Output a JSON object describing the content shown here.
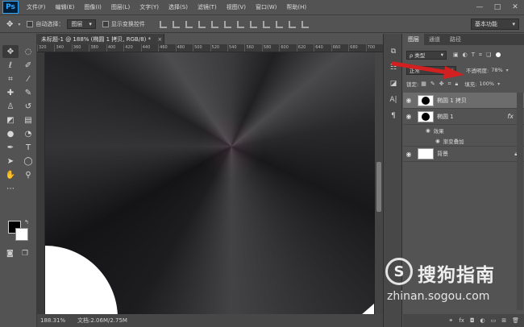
{
  "app": {
    "logo": "Ps"
  },
  "menu": [
    "文件(F)",
    "编辑(E)",
    "图像(I)",
    "图层(L)",
    "文字(Y)",
    "选择(S)",
    "滤镜(T)",
    "视图(V)",
    "窗口(W)",
    "帮助(H)"
  ],
  "window_controls": {
    "minimize": "—",
    "maximize": "□",
    "close": "✕"
  },
  "options": {
    "auto_select_label": "自动选择：",
    "auto_select_value": "图层",
    "show_transform_label": "显示变换控件",
    "workspace": "基本功能"
  },
  "document": {
    "tab_title": "未标题-1 @ 188% (椭圆 1 拷贝, RGB/8) *",
    "tab_close": "×",
    "ruler_ticks": [
      "320",
      "340",
      "360",
      "380",
      "400",
      "420",
      "440",
      "460",
      "480",
      "500",
      "520",
      "540",
      "560",
      "580",
      "600",
      "620",
      "640",
      "660",
      "680",
      "700"
    ],
    "status_zoom": "188.31%",
    "status_doc": "文档:2.06M/2.75M"
  },
  "layers_panel": {
    "tabs": [
      "图层",
      "通道",
      "路径"
    ],
    "filter_kind": "ρ 类型",
    "blend_mode": "正常",
    "opacity_label": "不透明度:",
    "opacity_value": "78%",
    "lock_label": "锁定:",
    "fill_label": "填充:",
    "fill_value": "100%",
    "layers": [
      {
        "name": "椭圆 1 拷贝",
        "selected": true
      },
      {
        "name": "椭圆 1",
        "fx": "fx",
        "effects_label": "效果",
        "effect": "渐变叠加"
      },
      {
        "name": "背景",
        "locked": true
      }
    ]
  },
  "watermark": {
    "logo": "S",
    "brand": "搜狗指南",
    "url": "zhinan.sogou.com"
  },
  "colors": {
    "ui_bg": "#535353",
    "canvas_dark": "#1b1b1d",
    "arrow_red": "#d1201f",
    "selected_layer": "#6c6c6c"
  }
}
